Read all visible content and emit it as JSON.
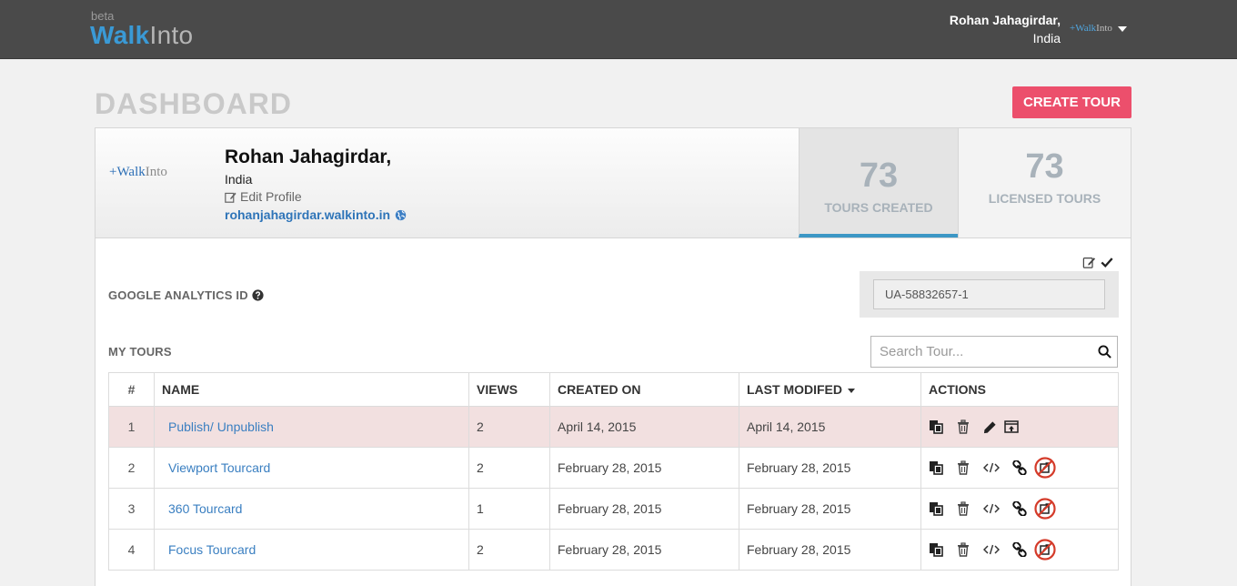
{
  "header": {
    "logo_beta": "beta",
    "logo_walk": "Walk",
    "logo_into": "Into",
    "user_name": "Rohan Jahagirdar,",
    "user_country": "India",
    "mini_logo_walk": "+Walk",
    "mini_logo_into": "Into"
  },
  "page": {
    "title": "DASHBOARD",
    "create_button": "CREATE TOUR"
  },
  "profile": {
    "logo_walk": "+Walk",
    "logo_into": "Into",
    "name": "Rohan Jahagirdar,",
    "country": "India",
    "edit_label": "Edit Profile",
    "url": "rohanjahagirdar.walkinto.in"
  },
  "stats": {
    "tours_created": "73",
    "tours_created_label": "TOURS CREATED",
    "licensed_tours": "73",
    "licensed_tours_label": "LICENSED TOURS"
  },
  "analytics": {
    "label": "GOOGLE ANALYTICS ID",
    "value": "UA-58832657-1"
  },
  "tours": {
    "heading": "MY TOURS",
    "search_placeholder": "Search Tour...",
    "columns": {
      "num": "#",
      "name": "NAME",
      "views": "VIEWS",
      "created": "CREATED ON",
      "modified": "LAST MODIFED",
      "actions": "ACTIONS"
    },
    "rows": [
      {
        "num": "1",
        "name": "Publish/ Unpublish",
        "views": "2",
        "created": "April 14, 2015",
        "modified": "April 14, 2015"
      },
      {
        "num": "2",
        "name": "Viewport Tourcard",
        "views": "2",
        "created": "February 28, 2015",
        "modified": "February 28, 2015"
      },
      {
        "num": "3",
        "name": "360 Tourcard",
        "views": "1",
        "created": "February 28, 2015",
        "modified": "February 28, 2015"
      },
      {
        "num": "4",
        "name": "Focus Tourcard",
        "views": "2",
        "created": "February 28, 2015",
        "modified": "February 28, 2015"
      }
    ]
  },
  "colors": {
    "topbar": "#4a4a4a",
    "accent_blue": "#3a9ad6",
    "create_button": "#ec4f6c",
    "highlight_row": "#f2e0e0",
    "tab_underline": "#3c97c5"
  },
  "icons": [
    "caret-down-icon",
    "edit-icon",
    "globe-icon",
    "edit-square-icon",
    "check-icon",
    "question-circle-icon",
    "search-icon",
    "copy-icon",
    "trash-icon",
    "pencil-icon",
    "publish-icon",
    "code-icon",
    "link-icon",
    "no-share-icon"
  ]
}
